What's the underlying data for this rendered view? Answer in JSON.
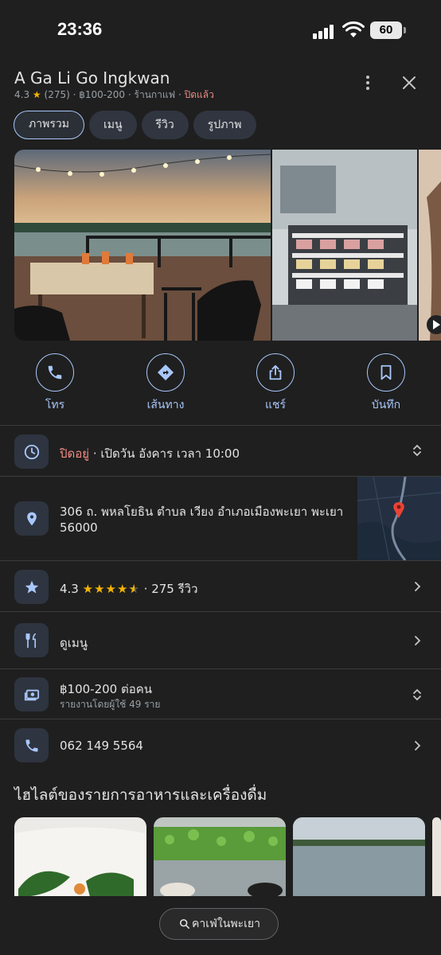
{
  "status": {
    "time": "23:36",
    "battery": "60"
  },
  "place": {
    "name": "A Ga Li Go Ingkwan",
    "rating": "4.3",
    "reviews_count": "(275)",
    "price": "฿100-200",
    "category": "ร้านกาแฟ",
    "state": "ปิดแล้ว"
  },
  "tabs": [
    {
      "label": "ภาพรวม",
      "active": true
    },
    {
      "label": "เมนู"
    },
    {
      "label": "รีวิว"
    },
    {
      "label": "รูปภาพ"
    }
  ],
  "actions": [
    {
      "label": "โทร",
      "icon": "phone-icon"
    },
    {
      "label": "เส้นทาง",
      "icon": "directions-icon"
    },
    {
      "label": "แชร์",
      "icon": "share-icon"
    },
    {
      "label": "บันทึก",
      "icon": "bookmark-icon"
    }
  ],
  "hours": {
    "status": "ปิดอยู่",
    "next_open": "เปิดวัน อังคาร เวลา 10:00"
  },
  "address": {
    "line1": "306 ถ. พหลโยธิน ตำบล เวียง อำเภอเมืองพะเยา พะเยา",
    "line2": "56000"
  },
  "rating_row": {
    "rating": "4.3",
    "stars": 4.5,
    "reviews": "275 รีวิว"
  },
  "menu_row": {
    "label": "ดูเมนู"
  },
  "price_row": {
    "price": "฿100-200 ต่อคน",
    "reported": "รายงานโดยผู้ใช้ 49 ราย"
  },
  "phone_row": {
    "number": "062 149 5564"
  },
  "highlights_title": "ไฮไลต์ของรายการอาหารและเครื่องดื่ม",
  "search_chip": {
    "label": "คาเฟ่ในพะเยา"
  },
  "colors": {
    "accent": "#a8c7fa",
    "star": "#f4b400",
    "closed": "#f28b82",
    "background": "#1f1f1f"
  }
}
